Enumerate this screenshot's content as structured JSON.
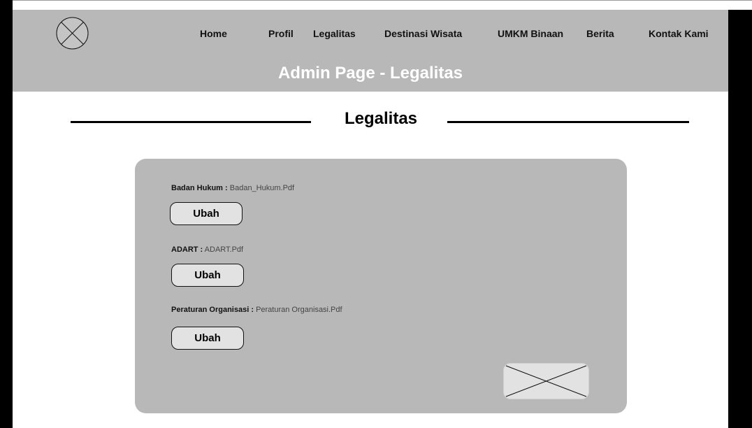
{
  "nav": {
    "items": [
      "Home",
      "Profil",
      "Legalitas",
      "Destinasi Wisata",
      "UMKM Binaan",
      "Berita",
      "Kontak Kami"
    ]
  },
  "header": {
    "title": "Admin Page - Legalitas"
  },
  "section": {
    "title": "Legalitas"
  },
  "documents": [
    {
      "label": "Badan Hukum :",
      "file": "Badan_Hukum.Pdf",
      "button": "Ubah"
    },
    {
      "label": "ADART :",
      "file": "ADART.Pdf",
      "button": "Ubah"
    },
    {
      "label": "Peraturan Organisasi :",
      "file": "Peraturan Organisasi.Pdf",
      "button": "Ubah"
    }
  ],
  "colors": {
    "header_bg": "#b8b8b8",
    "card_bg": "#b8b8b8",
    "button_bg": "#e2e2e2"
  },
  "icons": {
    "logo": "placeholder-x-icon",
    "image_placeholder": "placeholder-x-icon"
  }
}
